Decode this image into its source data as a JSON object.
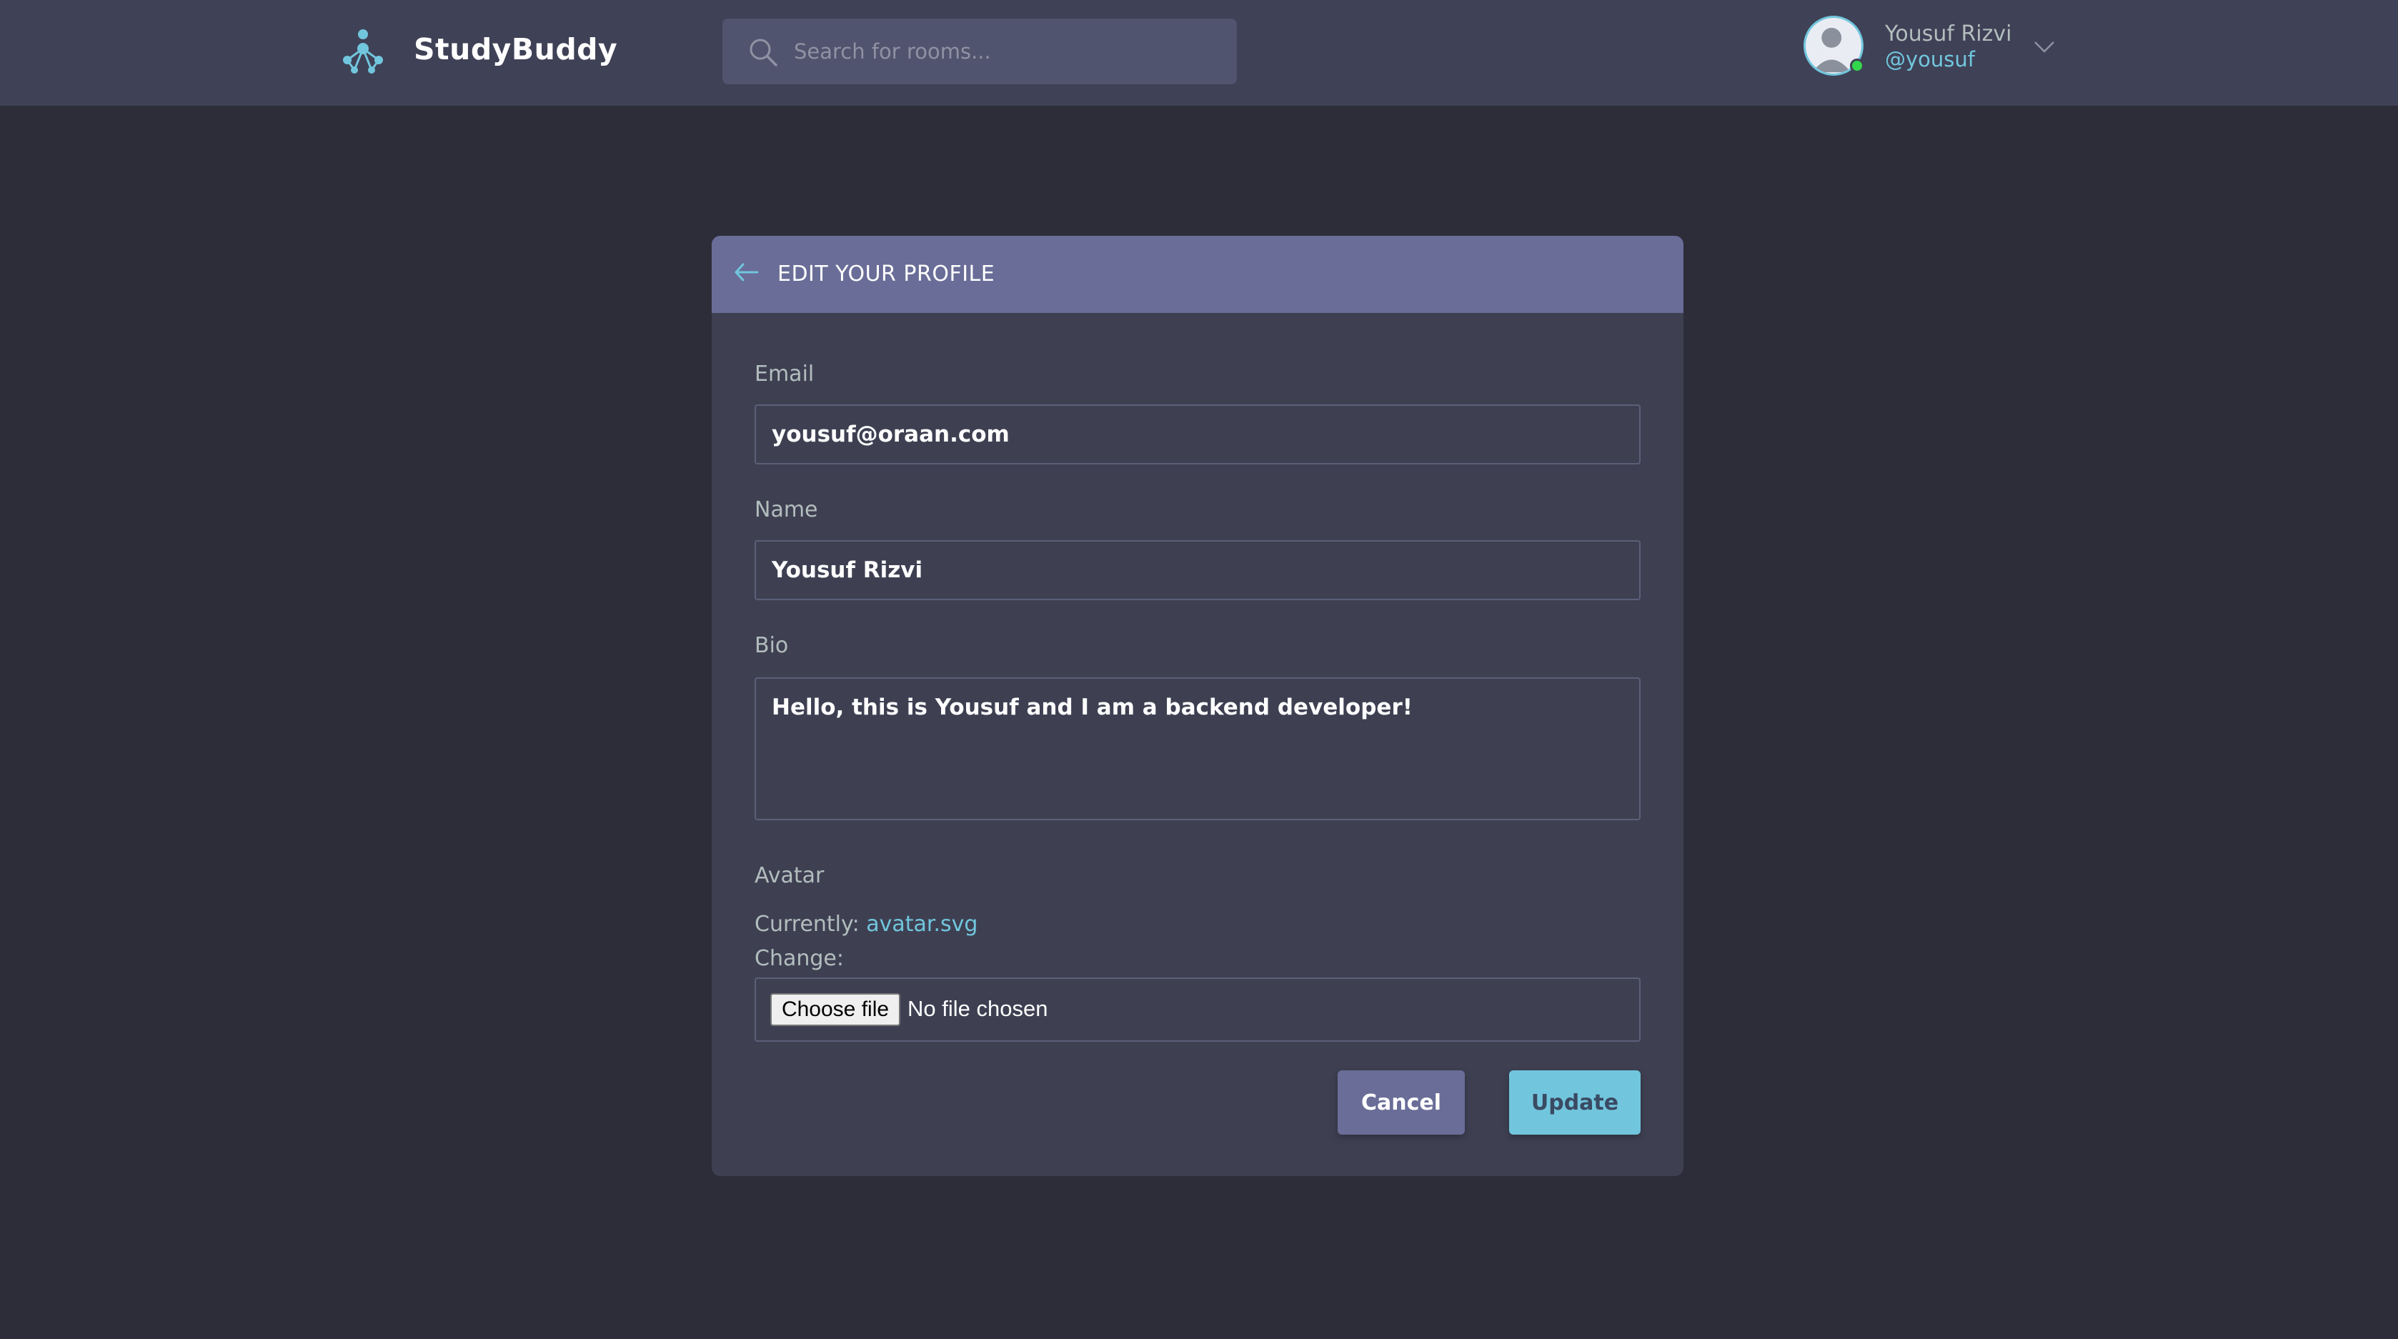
{
  "header": {
    "brand": "StudyBuddy",
    "search_placeholder": "Search for rooms...",
    "user": {
      "name": "Yousuf Rizvi",
      "handle": "@yousuf",
      "status": "online"
    }
  },
  "form": {
    "title": "EDIT YOUR PROFILE",
    "email_label": "Email",
    "email_value": "yousuf@oraan.com",
    "name_label": "Name",
    "name_value": "Yousuf Rizvi",
    "bio_label": "Bio",
    "bio_value": "Hello, this is Yousuf and I am a backend developer!",
    "avatar_label": "Avatar",
    "currently_label": "Currently:",
    "current_file": "avatar.svg",
    "change_label": "Change:",
    "choose_file_label": "Choose file",
    "no_file_text": "No file chosen",
    "cancel_label": "Cancel",
    "update_label": "Update"
  },
  "colors": {
    "page_bg": "#2d2d39",
    "header_bg": "#3f4156",
    "card_bg": "#3e4052",
    "card_head_bg": "#696d97",
    "accent": "#71c6dd",
    "online": "#32d74b"
  },
  "icons": [
    "logo-icon",
    "search-icon",
    "avatar-icon",
    "chevron-down-icon",
    "back-arrow-icon"
  ]
}
